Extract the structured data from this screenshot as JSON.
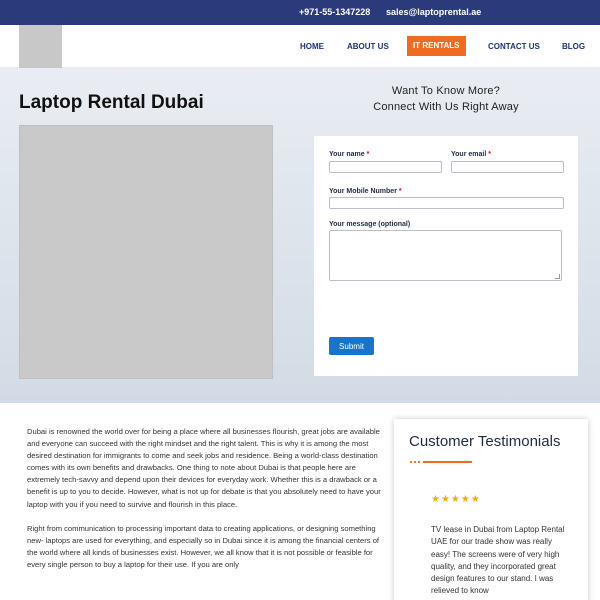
{
  "topbar": {
    "phone": "+971-55-1347228",
    "email": "sales@laptoprental.ae",
    "background": "#2b3a7b"
  },
  "nav": {
    "items": [
      "HOME",
      "ABOUT US",
      "IT RENTALS",
      "CONTACT US",
      "BLOG"
    ],
    "active": "IT RENTALS",
    "active_color": "#ee6b22",
    "text_color": "#1f3272"
  },
  "hero": {
    "title": "Laptop Rental Dubai",
    "cta_line1": "Want To Know More?",
    "cta_line2": "Connect With Us Right Away"
  },
  "form": {
    "name_label": "Your name",
    "email_label": "Your email",
    "mobile_label": "Your Mobile Number",
    "message_label": "Your message (optional)",
    "required_mark": "*",
    "submit_label": "Submit",
    "submit_color": "#1a73c8"
  },
  "article": {
    "paragraphs": [
      "Dubai is renowned the world over for being a place where all businesses flourish, great jobs are available and everyone can succeed with the right mindset and the right talent. This is why it is among the most desired destination for immigrants to come and seek jobs and residence. Being a world-class destination comes with its own benefits and drawbacks. One thing to note about Dubai is that people here are extremely tech-savvy and depend upon their devices for everyday work. Whether this is a drawback or a benefit is up to you to decide. However, what is not up for debate is that you absolutely need to have your laptop with you if you need to survive and flourish in this place.",
      "Right from communication to processing important data to creating applications, or designing something new- laptops are used for everything, and especially so in Dubai since it is among the financial centers of the world where all kinds of businesses exist. However, we all know that it is not possible or feasible for every single person to buy a laptop for their use. If you are only"
    ]
  },
  "testimonials": {
    "title": "Customer Testimonials",
    "stars": "★★★★★",
    "rating": 5,
    "text": "TV lease in Dubai from Laptop Rental UAE for our trade show was really easy! The screens were of very high quality, and they incorporated great design features to our stand. I was relieved to know"
  }
}
